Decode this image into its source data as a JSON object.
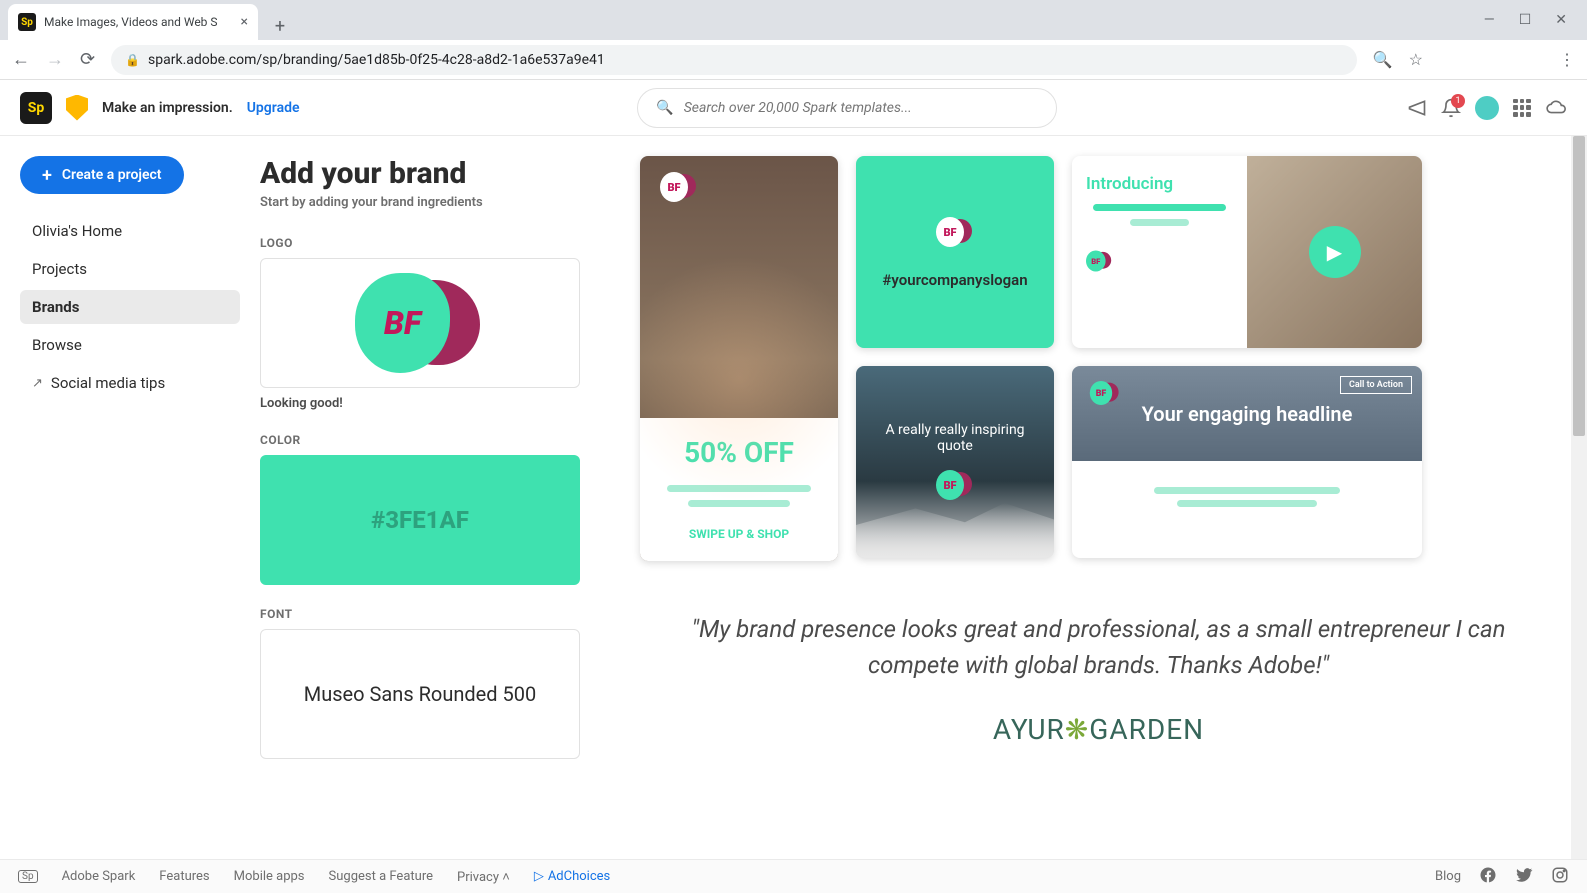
{
  "browser": {
    "tab_title": "Make Images, Videos and Web S",
    "url": "spark.adobe.com/sp/branding/5ae1d85b-0f25-4c28-a8d2-1a6e537a9e41"
  },
  "header": {
    "logo_text": "Sp",
    "impression_text": "Make an impression.",
    "upgrade_text": "Upgrade",
    "search_placeholder": "Search over 20,000 Spark templates...",
    "notification_count": "1"
  },
  "sidebar": {
    "create_label": "Create a project",
    "items": [
      {
        "label": "Olivia's Home"
      },
      {
        "label": "Projects"
      },
      {
        "label": "Brands"
      },
      {
        "label": "Browse"
      },
      {
        "label": "Social media tips"
      }
    ]
  },
  "brand": {
    "title": "Add your brand",
    "subtitle": "Start by adding your brand ingredients",
    "logo_label": "LOGO",
    "logo_text": "BF",
    "logo_caption": "Looking good!",
    "color_label": "COLOR",
    "color_value": "#3FE1AF",
    "font_label": "FONT",
    "font_value": "Museo Sans Rounded 500"
  },
  "previews": {
    "fifty_off": "50% OFF",
    "swipe": "SWIPE UP & SHOP",
    "slogan": "#yourcompanyslogan",
    "introducing": "Introducing",
    "quote_card": "A really really inspiring quote",
    "headline": "Your engaging headline",
    "cta": "Call to Action",
    "bf": "BF"
  },
  "testimonial": {
    "quote": "\"My brand presence looks great and professional, as a small entrepreneur I can compete with global brands. Thanks Adobe!\"",
    "author_prefix": "AYUR",
    "author_suffix": "GARDEN"
  },
  "footer": {
    "mark": "Sp",
    "items": [
      "Adobe Spark",
      "Features",
      "Mobile apps",
      "Suggest a Feature",
      "Privacy"
    ],
    "adchoices": "AdChoices",
    "blog": "Blog"
  }
}
